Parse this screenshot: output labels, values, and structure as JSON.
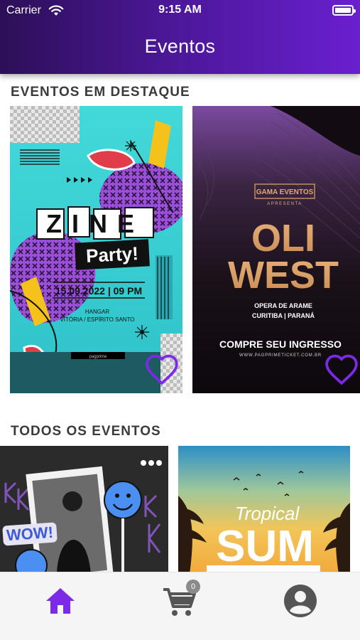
{
  "status_bar": {
    "carrier": "Carrier",
    "time": "9:15 AM"
  },
  "header": {
    "title": "Eventos"
  },
  "featured": {
    "title": "EVENTOS EM DESTAQUE",
    "cards": [
      {
        "name": "zine-party",
        "headline": "ZINE",
        "subheadline": "Party!",
        "date": "15.09.2022 | 09 PM",
        "venue": "HANGAR",
        "location": "VITÓRIA / ESPÍRITO SANTO",
        "footer": "pagprime"
      },
      {
        "name": "oli-west",
        "organizer": "GAMA EVENTOS",
        "presents": "APRESENTA",
        "artist_line1": "OLI",
        "artist_line2": "WEST",
        "venue": "OPERA DE ARAME",
        "location": "CURITIBA | PARANÁ",
        "cta": "COMPRE SEU INGRESSO",
        "website": "WWW.PAGPRIMETICKET.COM.BR"
      }
    ]
  },
  "all_events": {
    "title": "TODOS OS EVENTOS",
    "cards": [
      {
        "name": "wow",
        "sticker": "WOW!"
      },
      {
        "name": "tropical-summer",
        "script": "Tropical",
        "headline": "SUM"
      }
    ]
  },
  "tabbar": {
    "cart_count": "0"
  },
  "colors": {
    "accent": "#7c2ae8",
    "header_start": "#2c0f57",
    "header_end": "#6a1fd0",
    "tab_inactive": "#555555"
  }
}
